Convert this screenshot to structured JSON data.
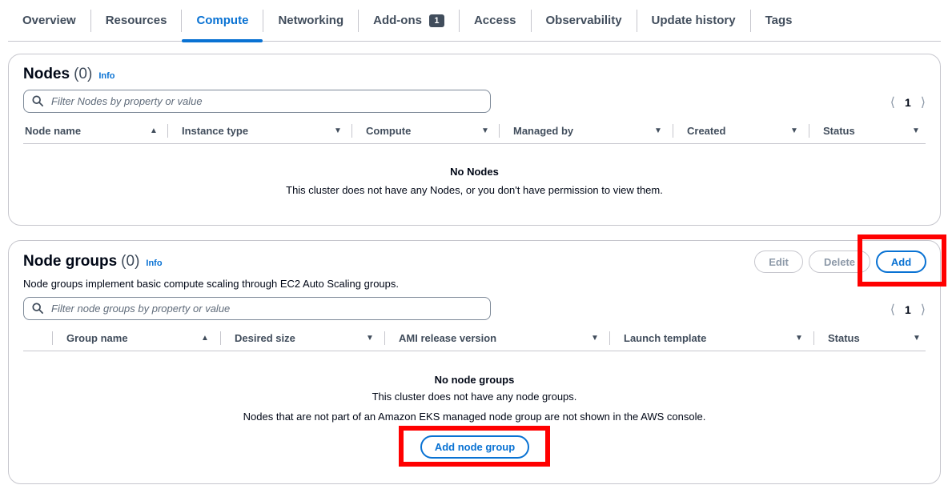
{
  "tabs": [
    {
      "label": "Overview"
    },
    {
      "label": "Resources"
    },
    {
      "label": "Compute",
      "active": true
    },
    {
      "label": "Networking"
    },
    {
      "label": "Add-ons",
      "badge": "1"
    },
    {
      "label": "Access"
    },
    {
      "label": "Observability"
    },
    {
      "label": "Update history"
    },
    {
      "label": "Tags"
    }
  ],
  "nodes": {
    "title": "Nodes",
    "count": "(0)",
    "info": "Info",
    "filter_placeholder": "Filter Nodes by property or value",
    "page": "1",
    "columns": [
      "Node name",
      "Instance type",
      "Compute",
      "Managed by",
      "Created",
      "Status"
    ],
    "empty_title": "No Nodes",
    "empty_message": "This cluster does not have any Nodes, or you don't have permission to view them."
  },
  "node_groups": {
    "title": "Node groups",
    "count": "(0)",
    "info": "Info",
    "description": "Node groups implement basic compute scaling through EC2 Auto Scaling groups.",
    "edit_label": "Edit",
    "delete_label": "Delete",
    "add_label": "Add",
    "filter_placeholder": "Filter node groups by property or value",
    "page": "1",
    "columns": [
      "Group name",
      "Desired size",
      "AMI release version",
      "Launch template",
      "Status"
    ],
    "empty_title": "No node groups",
    "empty_message": "This cluster does not have any node groups.",
    "note": "Nodes that are not part of an Amazon EKS managed node group are not shown in the AWS console.",
    "add_node_group_label": "Add node group"
  },
  "colors": {
    "accent": "#0972d3",
    "highlight": "#ff0000",
    "border": "#c6c6cd"
  }
}
